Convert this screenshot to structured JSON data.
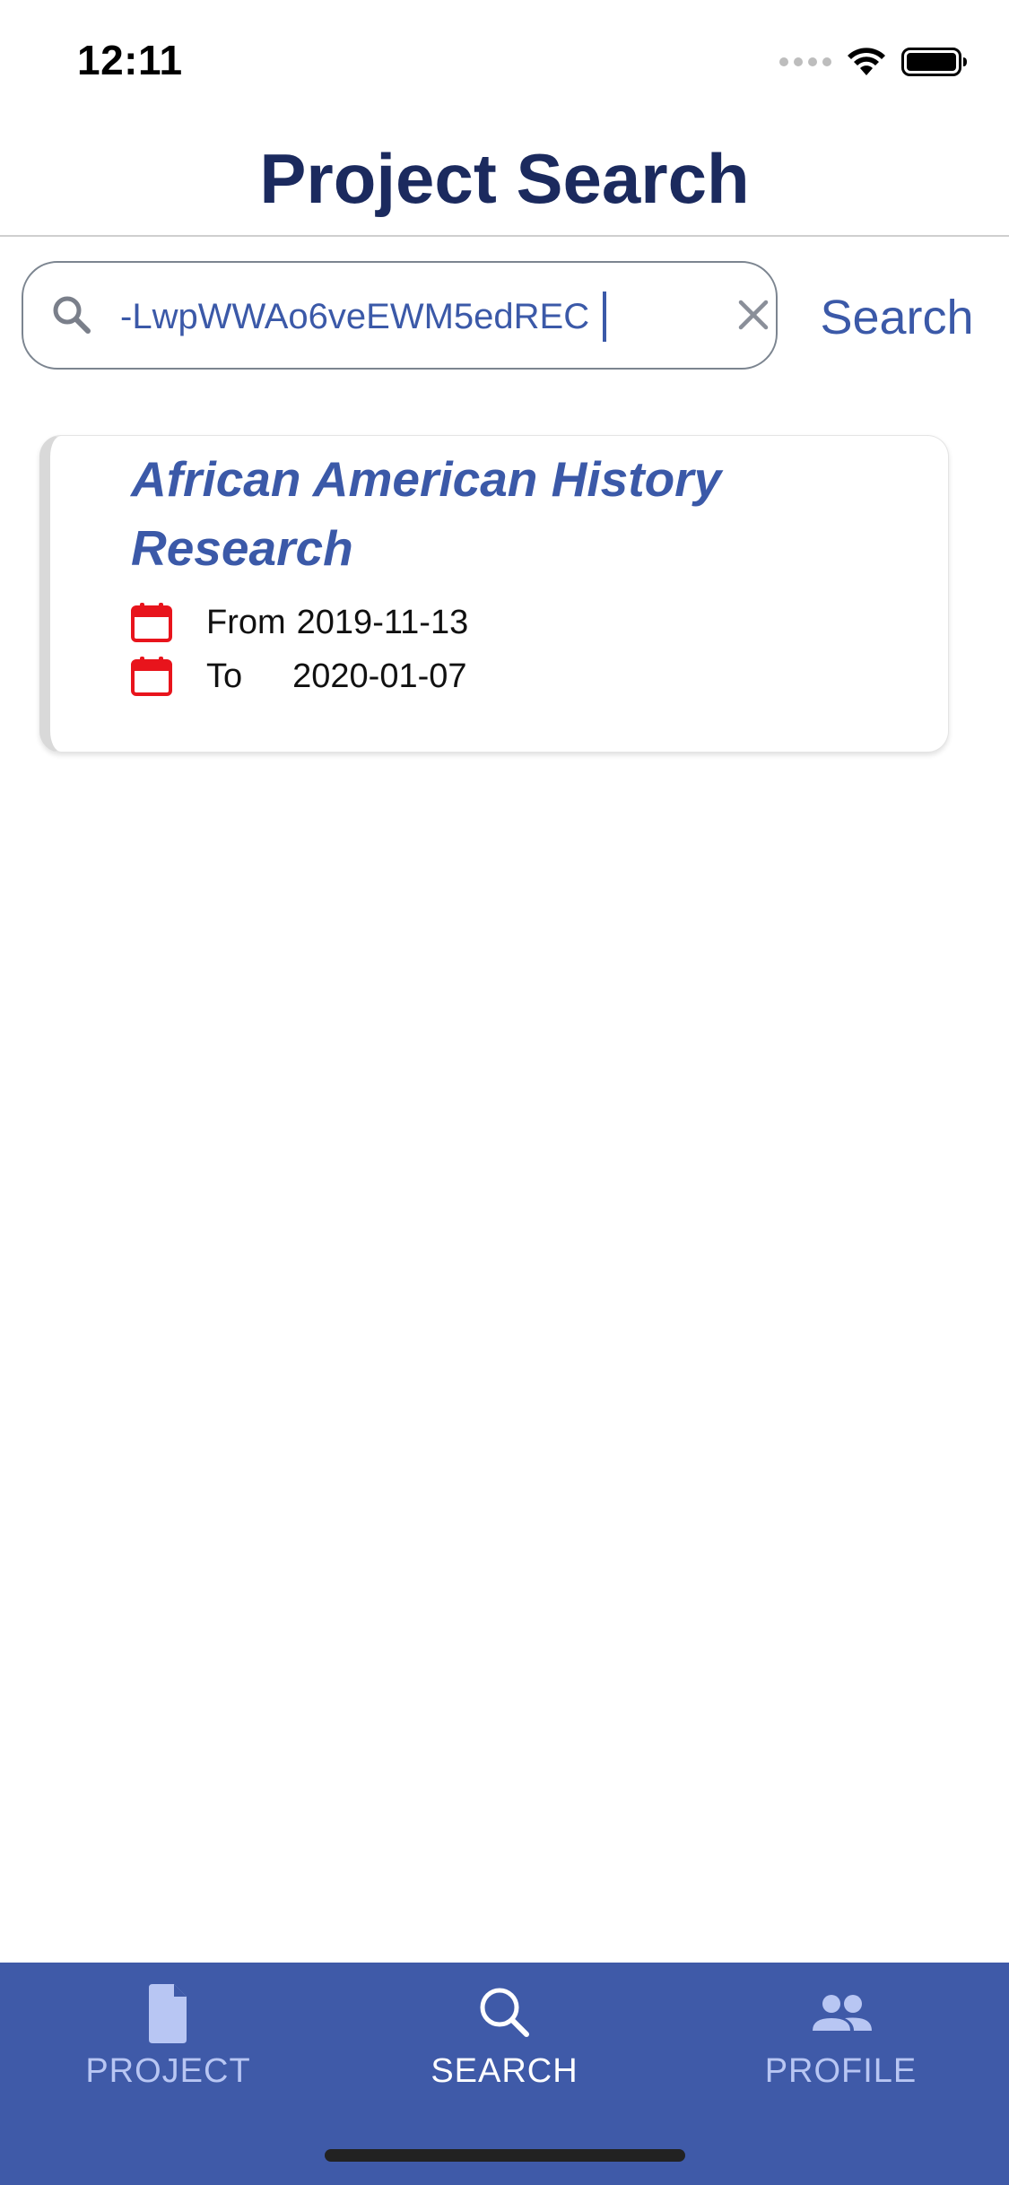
{
  "status_bar": {
    "time": "12:11"
  },
  "header": {
    "title": "Project Search"
  },
  "search": {
    "value": "-LwpWWAo6veEWM5edREC",
    "placeholder": "",
    "button_label": "Search"
  },
  "results": [
    {
      "title": "African American History Research",
      "from_label": "From",
      "from_date": "2019-11-13",
      "to_label": "To",
      "to_date": "2020-01-07"
    }
  ],
  "tabs": [
    {
      "label": "PROJECT",
      "icon": "document-icon",
      "active": false
    },
    {
      "label": "SEARCH",
      "icon": "search-icon",
      "active": true
    },
    {
      "label": "PROFILE",
      "icon": "people-icon",
      "active": false
    }
  ],
  "colors": {
    "primary": "#3f5aa8",
    "title": "#1b2a5e",
    "link": "#3b59a8",
    "calendar": "#e8141c"
  }
}
